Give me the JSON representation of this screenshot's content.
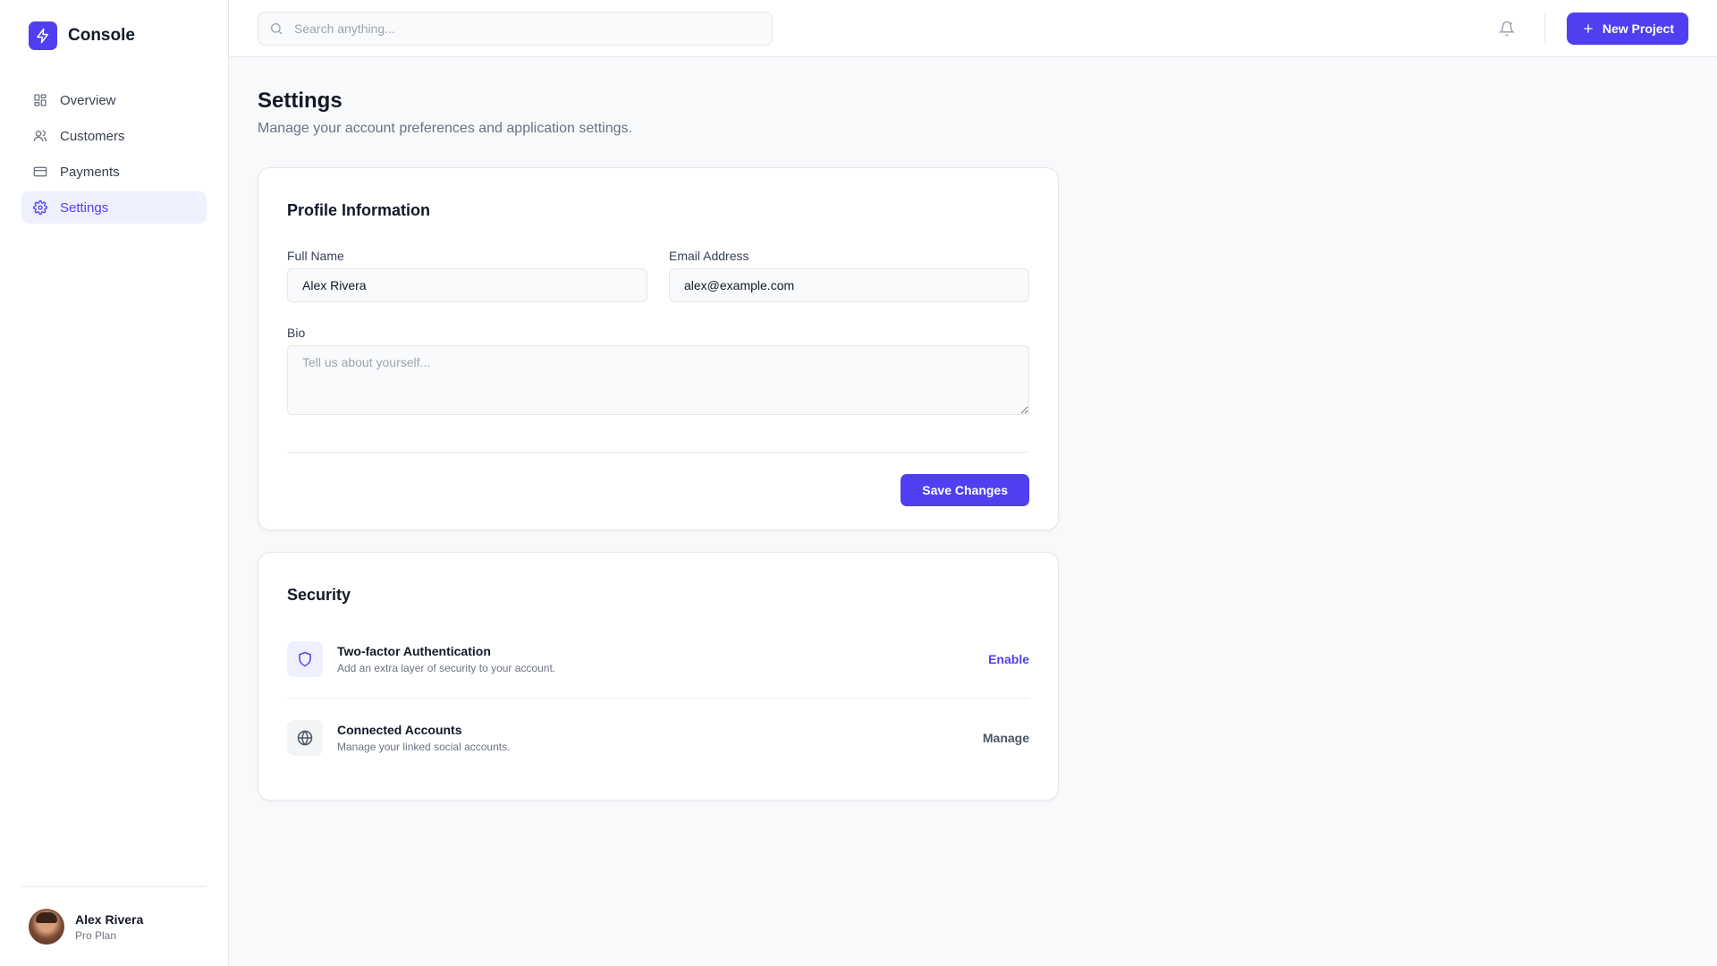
{
  "brand": {
    "name": "Console"
  },
  "sidebar": {
    "items": [
      {
        "label": "Overview",
        "icon": "grid-icon"
      },
      {
        "label": "Customers",
        "icon": "users-icon"
      },
      {
        "label": "Payments",
        "icon": "credit-card-icon"
      },
      {
        "label": "Settings",
        "icon": "gear-icon",
        "active": true
      }
    ],
    "user": {
      "name": "Alex Rivera",
      "plan": "Pro Plan"
    }
  },
  "topbar": {
    "search_placeholder": "Search anything...",
    "new_project_label": "New Project"
  },
  "page": {
    "title": "Settings",
    "subtitle": "Manage your account preferences and application settings."
  },
  "profile_card": {
    "title": "Profile Information",
    "full_name_label": "Full Name",
    "full_name_value": "Alex Rivera",
    "email_label": "Email Address",
    "email_value": "alex@example.com",
    "bio_label": "Bio",
    "bio_placeholder": "Tell us about yourself...",
    "save_label": "Save Changes"
  },
  "security_card": {
    "title": "Security",
    "items": [
      {
        "title": "Two-factor Authentication",
        "desc": "Add an extra layer of security to your account.",
        "action": "Enable",
        "icon": "shield-icon"
      },
      {
        "title": "Connected Accounts",
        "desc": "Manage your linked social accounts.",
        "action": "Manage",
        "icon": "globe-icon"
      }
    ]
  },
  "colors": {
    "accent": "#4f3ff0",
    "active_bg": "#eef0fd",
    "page_bg": "#f8f9fb"
  }
}
